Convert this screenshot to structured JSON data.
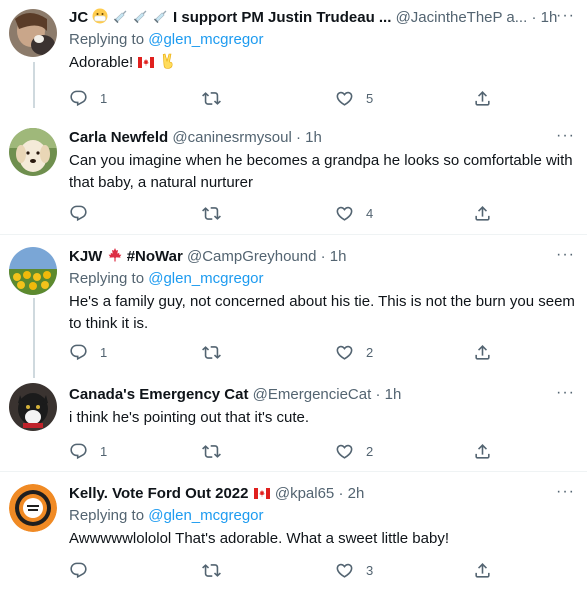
{
  "tweets": [
    {
      "name": "JC",
      "name_suffix": "I support PM Justin Trudeau ...",
      "handle": "@JacintheTheP a...",
      "time": "1h",
      "replying_label": "Replying to",
      "replying_to": "@glen_mcgregor",
      "text": "Adorable!",
      "replies": "1",
      "retweets": "",
      "likes": "5"
    },
    {
      "name": "Carla Newfeld",
      "handle": "@caninesrmysoul",
      "time": "1h",
      "text": "Can you imagine when he becomes a grandpa he looks so comfortable with that baby, a natural nurturer",
      "replies": "",
      "retweets": "",
      "likes": "4"
    },
    {
      "name": "KJW",
      "name_suffix": "#NoWar",
      "handle": "@CampGreyhound",
      "time": "1h",
      "replying_label": "Replying to",
      "replying_to": "@glen_mcgregor",
      "text": "He's a family guy, not concerned about his tie. This is not the burn you seem to think it is.",
      "replies": "1",
      "retweets": "",
      "likes": "2"
    },
    {
      "name": "Canada's Emergency Cat",
      "handle": "@EmergencieCat",
      "time": "1h",
      "text": "i think he's pointing out that it's cute.",
      "replies": "1",
      "retweets": "",
      "likes": "2"
    },
    {
      "name": "Kelly. Vote Ford Out 2022",
      "handle": "@kpal65",
      "time": "2h",
      "replying_label": "Replying to",
      "replying_to": "@glen_mcgregor",
      "text": "Awwwwwlololol That's adorable. What a sweet little baby!",
      "replies": "",
      "retweets": "",
      "likes": "3"
    }
  ],
  "separator": "·",
  "more_glyph": "···",
  "colors": {
    "link": "#1d9bf0",
    "secondary_text": "#536471",
    "divider": "#eff3f4",
    "thread_line": "#cfd9de"
  },
  "icons": [
    "reply-icon",
    "retweet-icon",
    "like-icon",
    "share-icon",
    "more-icon",
    "canada-flag-icon",
    "syringe-icon",
    "mask-face-icon",
    "victory-hand-icon",
    "maple-leaf-icon"
  ]
}
